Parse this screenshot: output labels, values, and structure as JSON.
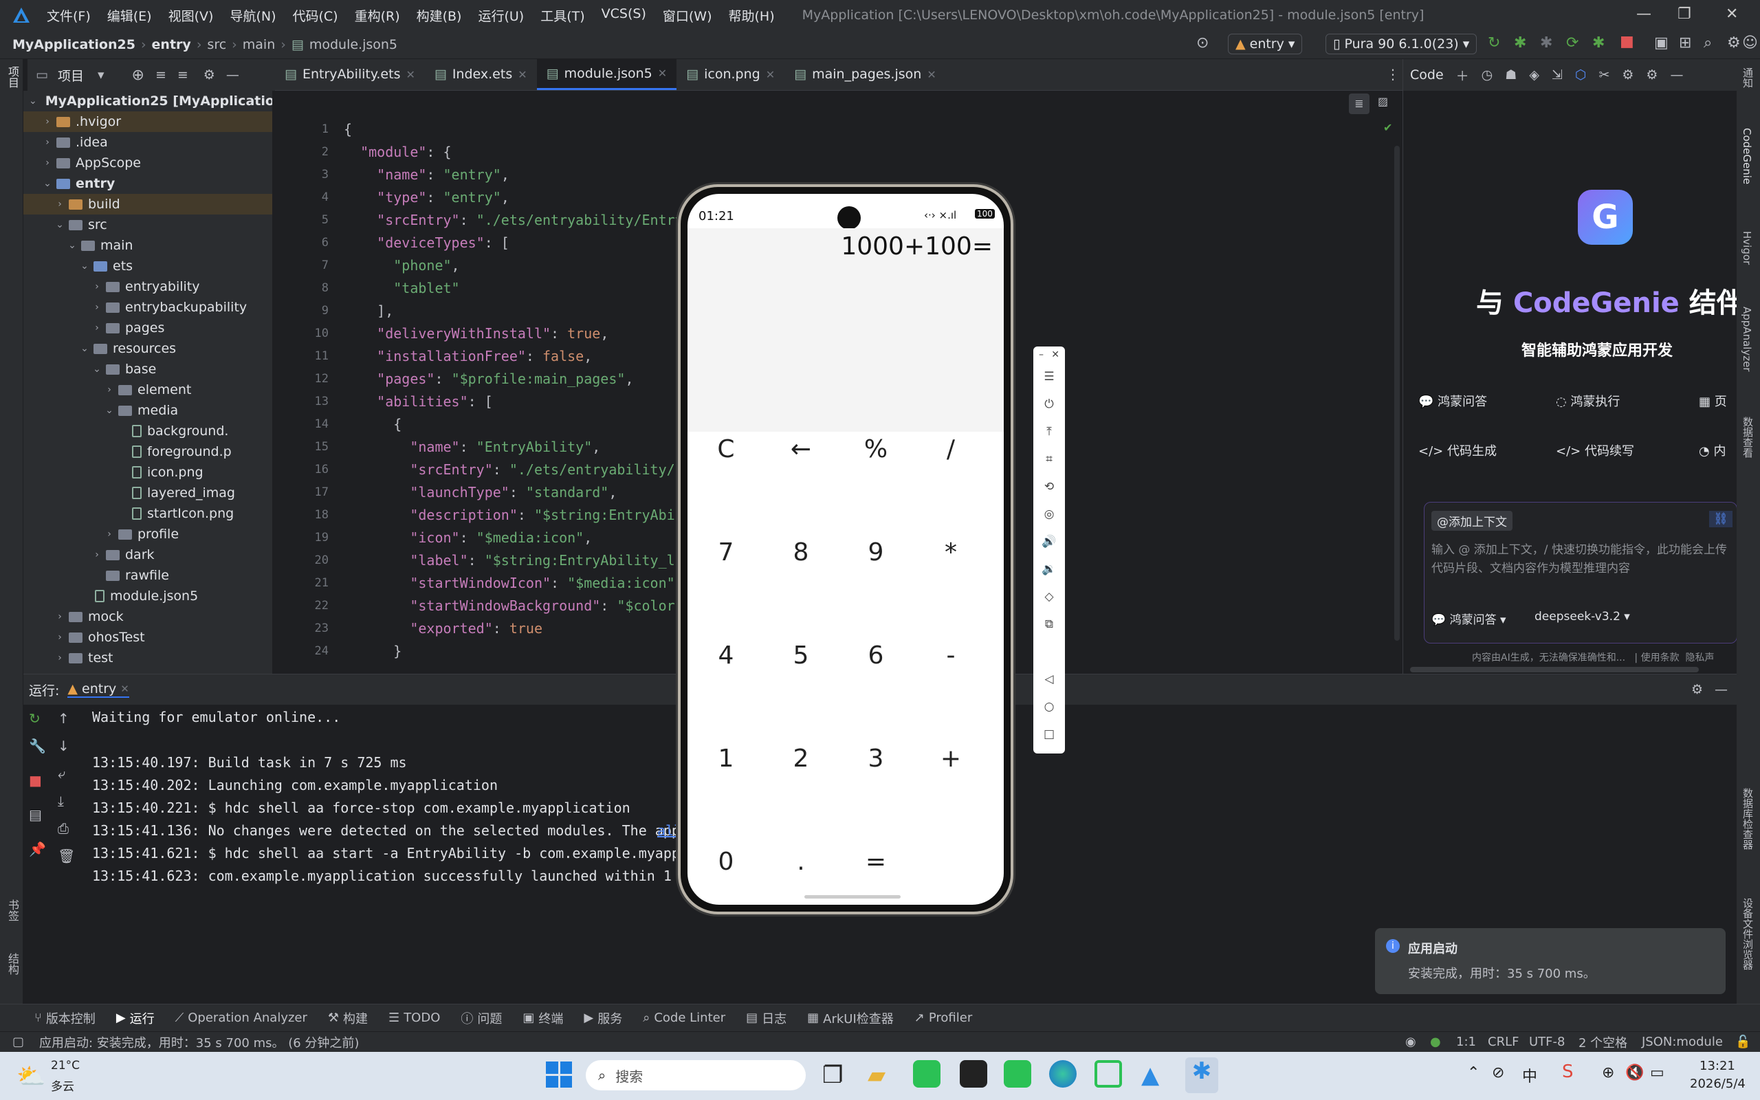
{
  "app": {
    "menu": [
      "文件(F)",
      "编辑(E)",
      "视图(V)",
      "导航(N)",
      "代码(C)",
      "重构(R)",
      "构建(B)",
      "运行(U)",
      "工具(T)",
      "VCS(S)",
      "窗口(W)",
      "帮助(H)"
    ],
    "window_title": "MyApplication [C:\\Users\\LENOVO\\Desktop\\xm\\oh.code\\MyApplication25] - module.json5 [entry]"
  },
  "breadcrumb": [
    "MyApplication25",
    "entry",
    "src",
    "main",
    "module.json5"
  ],
  "toolbar": {
    "module_select": "entry",
    "device_select": "Pura 90 6.1.0(23)"
  },
  "project": {
    "header": "项目"
  },
  "tabs": [
    {
      "label": "EntryAbility.ets",
      "active": false
    },
    {
      "label": "Index.ets",
      "active": false
    },
    {
      "label": "module.json5",
      "active": true
    },
    {
      "label": "icon.png",
      "active": false
    },
    {
      "label": "main_pages.json",
      "active": false
    }
  ],
  "tree": [
    {
      "label": "MyApplication25 [MyApplication]",
      "indent": 0,
      "arrow": "open",
      "type": "folder-blue",
      "bold": true
    },
    {
      "label": ".hvigor",
      "indent": 1,
      "arrow": "closed",
      "type": "folder-orange",
      "hl": true
    },
    {
      "label": ".idea",
      "indent": 1,
      "arrow": "closed",
      "type": "folder"
    },
    {
      "label": "AppScope",
      "indent": 1,
      "arrow": "closed",
      "type": "folder"
    },
    {
      "label": "entry",
      "indent": 1,
      "arrow": "open",
      "type": "folder-blue",
      "bold": true
    },
    {
      "label": "build",
      "indent": 2,
      "arrow": "closed",
      "type": "folder-orange",
      "hl": true
    },
    {
      "label": "src",
      "indent": 2,
      "arrow": "open",
      "type": "folder"
    },
    {
      "label": "main",
      "indent": 3,
      "arrow": "open",
      "type": "folder"
    },
    {
      "label": "ets",
      "indent": 4,
      "arrow": "open",
      "type": "folder-blue"
    },
    {
      "label": "entryability",
      "indent": 5,
      "arrow": "closed",
      "type": "folder"
    },
    {
      "label": "entrybackupability",
      "indent": 5,
      "arrow": "closed",
      "type": "folder"
    },
    {
      "label": "pages",
      "indent": 5,
      "arrow": "closed",
      "type": "folder"
    },
    {
      "label": "resources",
      "indent": 4,
      "arrow": "open",
      "type": "folder"
    },
    {
      "label": "base",
      "indent": 5,
      "arrow": "open",
      "type": "folder"
    },
    {
      "label": "element",
      "indent": 6,
      "arrow": "closed",
      "type": "folder"
    },
    {
      "label": "media",
      "indent": 6,
      "arrow": "open",
      "type": "folder"
    },
    {
      "label": "background.",
      "indent": 7,
      "arrow": "none",
      "type": "file"
    },
    {
      "label": "foreground.p",
      "indent": 7,
      "arrow": "none",
      "type": "file"
    },
    {
      "label": "icon.png",
      "indent": 7,
      "arrow": "none",
      "type": "file"
    },
    {
      "label": "layered_imag",
      "indent": 7,
      "arrow": "none",
      "type": "file"
    },
    {
      "label": "startIcon.png",
      "indent": 7,
      "arrow": "none",
      "type": "file"
    },
    {
      "label": "profile",
      "indent": 6,
      "arrow": "closed",
      "type": "folder"
    },
    {
      "label": "dark",
      "indent": 5,
      "arrow": "closed",
      "type": "folder"
    },
    {
      "label": "rawfile",
      "indent": 5,
      "arrow": "none",
      "type": "folder"
    },
    {
      "label": "module.json5",
      "indent": 4,
      "arrow": "none",
      "type": "file"
    },
    {
      "label": "mock",
      "indent": 2,
      "arrow": "closed",
      "type": "folder"
    },
    {
      "label": "ohosTest",
      "indent": 2,
      "arrow": "closed",
      "type": "folder"
    },
    {
      "label": "test",
      "indent": 2,
      "arrow": "closed",
      "type": "folder"
    }
  ],
  "code": [
    [
      [
        "p",
        "{"
      ]
    ],
    [
      [
        "p",
        "  "
      ],
      [
        "k",
        "\"module\""
      ],
      [
        "p",
        ": {"
      ]
    ],
    [
      [
        "p",
        "    "
      ],
      [
        "k",
        "\"name\""
      ],
      [
        "p",
        ": "
      ],
      [
        "s",
        "\"entry\""
      ],
      [
        "p",
        ","
      ]
    ],
    [
      [
        "p",
        "    "
      ],
      [
        "k",
        "\"type\""
      ],
      [
        "p",
        ": "
      ],
      [
        "s",
        "\"entry\""
      ],
      [
        "p",
        ","
      ]
    ],
    [
      [
        "p",
        "    "
      ],
      [
        "k",
        "\"srcEntry\""
      ],
      [
        "p",
        ": "
      ],
      [
        "s",
        "\"./ets/entryability/Entry"
      ]
    ],
    [
      [
        "p",
        "    "
      ],
      [
        "k",
        "\"deviceTypes\""
      ],
      [
        "p",
        ": ["
      ]
    ],
    [
      [
        "p",
        "      "
      ],
      [
        "s",
        "\"phone\""
      ],
      [
        "p",
        ","
      ]
    ],
    [
      [
        "p",
        "      "
      ],
      [
        "s",
        "\"tablet\""
      ]
    ],
    [
      [
        "p",
        "    ],"
      ]
    ],
    [
      [
        "p",
        "    "
      ],
      [
        "k",
        "\"deliveryWithInstall\""
      ],
      [
        "p",
        ": "
      ],
      [
        "b",
        "true"
      ],
      [
        "p",
        ","
      ]
    ],
    [
      [
        "p",
        "    "
      ],
      [
        "k",
        "\"installationFree\""
      ],
      [
        "p",
        ": "
      ],
      [
        "b",
        "false"
      ],
      [
        "p",
        ","
      ]
    ],
    [
      [
        "p",
        "    "
      ],
      [
        "k",
        "\"pages\""
      ],
      [
        "p",
        ": "
      ],
      [
        "s",
        "\"$profile:main_pages\""
      ],
      [
        "p",
        ","
      ]
    ],
    [
      [
        "p",
        "    "
      ],
      [
        "k",
        "\"abilities\""
      ],
      [
        "p",
        ": ["
      ]
    ],
    [
      [
        "p",
        "      {"
      ]
    ],
    [
      [
        "p",
        "        "
      ],
      [
        "k",
        "\"name\""
      ],
      [
        "p",
        ": "
      ],
      [
        "s",
        "\"EntryAbility\""
      ],
      [
        "p",
        ","
      ]
    ],
    [
      [
        "p",
        "        "
      ],
      [
        "k",
        "\"srcEntry\""
      ],
      [
        "p",
        ": "
      ],
      [
        "s",
        "\"./ets/entryability/E"
      ]
    ],
    [
      [
        "p",
        "        "
      ],
      [
        "k",
        "\"launchType\""
      ],
      [
        "p",
        ": "
      ],
      [
        "s",
        "\"standard\""
      ],
      [
        "p",
        ","
      ]
    ],
    [
      [
        "p",
        "        "
      ],
      [
        "k",
        "\"description\""
      ],
      [
        "p",
        ": "
      ],
      [
        "s",
        "\"$string:EntryAbil"
      ]
    ],
    [
      [
        "p",
        "        "
      ],
      [
        "k",
        "\"icon\""
      ],
      [
        "p",
        ": "
      ],
      [
        "s",
        "\"$media:icon\""
      ],
      [
        "p",
        ","
      ]
    ],
    [
      [
        "p",
        "        "
      ],
      [
        "k",
        "\"label\""
      ],
      [
        "p",
        ": "
      ],
      [
        "s",
        "\"$string:EntryAbility_la"
      ]
    ],
    [
      [
        "p",
        "        "
      ],
      [
        "k",
        "\"startWindowIcon\""
      ],
      [
        "p",
        ": "
      ],
      [
        "s",
        "\"$media:icon\""
      ],
      [
        "p",
        ","
      ]
    ],
    [
      [
        "p",
        "        "
      ],
      [
        "k",
        "\"startWindowBackground\""
      ],
      [
        "p",
        ": "
      ],
      [
        "s",
        "\"$color:"
      ]
    ],
    [
      [
        "p",
        "        "
      ],
      [
        "k",
        "\"exported\""
      ],
      [
        "p",
        ": "
      ],
      [
        "b",
        "true"
      ]
    ],
    [
      [
        "p",
        "      }"
      ]
    ]
  ],
  "run": {
    "label": "运行:",
    "tab": "entry",
    "console": [
      {
        "text": "Waiting for emulator online..."
      },
      {
        "text": ""
      },
      {
        "text": "13:15:40.197: Build task in 7 s 725 ms"
      },
      {
        "text": "13:15:40.202: Launching com.example.myapplication"
      },
      {
        "text": "13:15:40.221: $ hdc shell aa force-stop com.example.myapplication"
      },
      {
        "text": "13:15:41.136: No changes were detected on the selected modules. The app",
        "link": "all the modules."
      },
      {
        "text": "13:15:41.621: $ hdc shell aa start -a EntryAbility -b com.example.myapp"
      },
      {
        "text": "13:15:41.623: com.example.myapplication successfully launched within 1"
      }
    ]
  },
  "phone": {
    "time": "01:21",
    "battery": "100",
    "expression": "1000+100=",
    "keys": [
      [
        "C",
        "←",
        "%",
        "/"
      ],
      [
        "7",
        "8",
        "9",
        "*"
      ],
      [
        "4",
        "5",
        "6",
        "-"
      ],
      [
        "1",
        "2",
        "3",
        "+"
      ],
      [
        "0",
        ".",
        "=",
        ""
      ]
    ]
  },
  "codegenie": {
    "tab": "Code",
    "headline_prefix": "与",
    "brand": "CodeGenie",
    "headline_suffix": "结伴",
    "subtitle": "智能辅助鸿蒙应用开发",
    "features": [
      "鸿蒙问答",
      "鸿蒙执行",
      "页",
      "代码生成",
      "代码续写",
      "内"
    ],
    "add_context": "@添加上下文",
    "input_placeholder": "输入 @ 添加上下文，/ 快速切换功能指令，此功能会上传代码片段、文档内容作为模型推理内容",
    "mode": "鸿蒙问答",
    "model": "deepseek-v3.2",
    "disclaimer": "内容由AI生成，无法确保准确性和...   | 使用条款  隐私声"
  },
  "right_strip": [
    "通知",
    "CodeGenie",
    "Hvigor",
    "AppAnalyzer",
    "数据查看",
    "数据库检查器",
    "设备文件浏览器"
  ],
  "left_strip": [
    "项目",
    "书签",
    "结构"
  ],
  "bottom_tools": [
    "版本控制",
    "运行",
    "Operation Analyzer",
    "构建",
    "TODO",
    "问题",
    "终端",
    "服务",
    "Code Linter",
    "日志",
    "ArkUI检查器",
    "Profiler"
  ],
  "status": {
    "message": "应用启动: 安装完成，用时：35 s 700 ms。 (6 分钟之前)",
    "pos": "1:1",
    "eol": "CRLF",
    "enc": "UTF-8",
    "indent": "2 个空格",
    "filetype": "JSON:module"
  },
  "toast": {
    "title": "应用启动",
    "body": "安装完成，用时：35 s 700 ms。"
  },
  "taskbar": {
    "temp": "21°C",
    "weather": "多云",
    "search": "搜索",
    "time": "13:21",
    "date": "2026/5/4",
    "ime": "中"
  }
}
